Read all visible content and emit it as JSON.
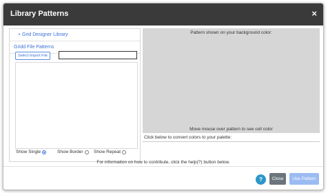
{
  "dialog": {
    "title": "Library Patterns",
    "close_glyph": "×"
  },
  "left": {
    "grid_designer_library": "+ Grid Designer Library",
    "gridd_file_patterns": "Gridd File Patterns",
    "select_import_file": "Select Import File",
    "import_value": ""
  },
  "options": {
    "show_single": "Show Single",
    "show_border": "Show Border",
    "show_repeat": "Show Repeat",
    "selected": "show_single"
  },
  "preview": {
    "top_text": "Pattern shown on your background color:",
    "bottom_text": "Move mouse over pattern to see cell color",
    "convert_text": "Click below to convert colors to your palette:"
  },
  "info": "For information on how to contribute, click the help(?) button below.",
  "footer": {
    "help_label": "?",
    "close_label": "Close",
    "use_label": "Use Pattern"
  },
  "colors": {
    "titlebar": "#3a3a3a",
    "link": "#3b6fd8",
    "help": "#2a97c9",
    "close_btn": "#6c757d",
    "use_btn": "#9bbbf2",
    "preview_bg": "#d6d6d6"
  }
}
